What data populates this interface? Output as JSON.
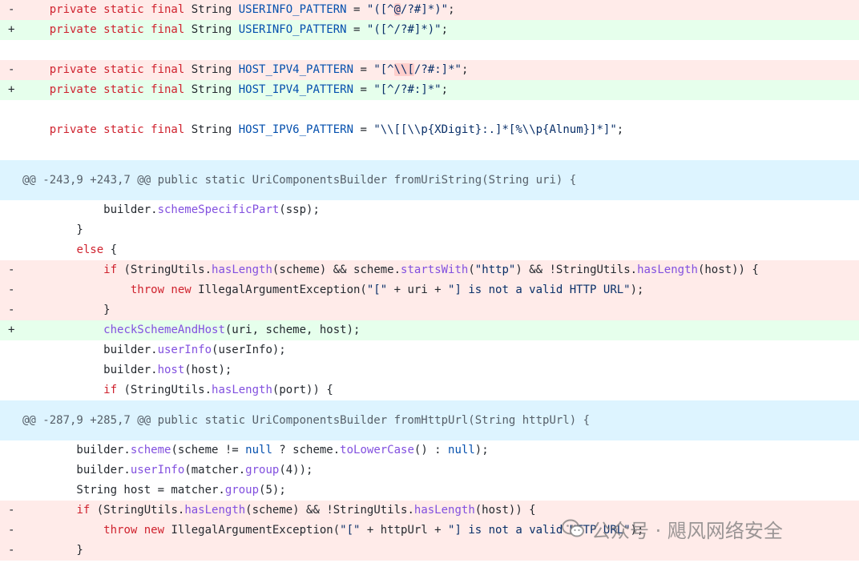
{
  "diff": {
    "rows": [
      {
        "type": "del",
        "marker": "-",
        "seg": [
          {
            "t": "    "
          },
          {
            "t": "private static final",
            "c": "kw"
          },
          {
            "t": " String "
          },
          {
            "t": "USERINFO_PATTERN",
            "c": "cf"
          },
          {
            "t": " = "
          },
          {
            "t": "\"([^",
            "c": "str"
          },
          {
            "t": "@",
            "c": "str hl"
          },
          {
            "t": "/?#]*)\"",
            "c": "str"
          },
          {
            "t": ";"
          }
        ]
      },
      {
        "type": "add",
        "marker": "+",
        "seg": [
          {
            "t": "    "
          },
          {
            "t": "private static final",
            "c": "kw"
          },
          {
            "t": " String "
          },
          {
            "t": "USERINFO_PATTERN",
            "c": "cf"
          },
          {
            "t": " = "
          },
          {
            "t": "\"([^/?#]*)\"",
            "c": "str"
          },
          {
            "t": ";"
          }
        ]
      },
      {
        "type": "blank",
        "marker": "",
        "seg": []
      },
      {
        "type": "del",
        "marker": "-",
        "seg": [
          {
            "t": "    "
          },
          {
            "t": "private static final",
            "c": "kw"
          },
          {
            "t": " String "
          },
          {
            "t": "HOST_IPV4_PATTERN",
            "c": "cf"
          },
          {
            "t": " = "
          },
          {
            "t": "\"[^",
            "c": "str"
          },
          {
            "t": "\\\\[",
            "c": "str hl"
          },
          {
            "t": "/?#:]*\"",
            "c": "str"
          },
          {
            "t": ";"
          }
        ]
      },
      {
        "type": "add",
        "marker": "+",
        "seg": [
          {
            "t": "    "
          },
          {
            "t": "private static final",
            "c": "kw"
          },
          {
            "t": " String "
          },
          {
            "t": "HOST_IPV4_PATTERN",
            "c": "cf"
          },
          {
            "t": " = "
          },
          {
            "t": "\"[^/?#:]*\"",
            "c": "str"
          },
          {
            "t": ";"
          }
        ]
      },
      {
        "type": "blank",
        "marker": "",
        "seg": []
      },
      {
        "type": "ctx",
        "marker": "",
        "seg": [
          {
            "t": "    "
          },
          {
            "t": "private static final",
            "c": "kw"
          },
          {
            "t": " String "
          },
          {
            "t": "HOST_IPV6_PATTERN",
            "c": "cf"
          },
          {
            "t": " = "
          },
          {
            "t": "\"\\\\[[\\\\p{XDigit}:.]*[%\\\\p{Alnum}]*]\"",
            "c": "str"
          },
          {
            "t": ";"
          }
        ]
      },
      {
        "type": "blank",
        "marker": "",
        "seg": []
      },
      {
        "type": "hunk",
        "text": "@@ -243,9 +243,7 @@ public static UriComponentsBuilder fromUriString(String uri) {"
      },
      {
        "type": "ctx",
        "marker": "",
        "seg": [
          {
            "t": "            builder."
          },
          {
            "t": "schemeSpecificPart",
            "c": "fn"
          },
          {
            "t": "(ssp);"
          }
        ]
      },
      {
        "type": "ctx",
        "marker": "",
        "seg": [
          {
            "t": "        }"
          }
        ]
      },
      {
        "type": "ctx",
        "marker": "",
        "seg": [
          {
            "t": "        "
          },
          {
            "t": "else",
            "c": "kw"
          },
          {
            "t": " {"
          }
        ]
      },
      {
        "type": "del",
        "marker": "-",
        "seg": [
          {
            "t": "            "
          },
          {
            "t": "if",
            "c": "kw"
          },
          {
            "t": " (StringUtils."
          },
          {
            "t": "hasLength",
            "c": "fn"
          },
          {
            "t": "(scheme) && scheme."
          },
          {
            "t": "startsWith",
            "c": "fn"
          },
          {
            "t": "("
          },
          {
            "t": "\"http\"",
            "c": "str"
          },
          {
            "t": ") && !StringUtils."
          },
          {
            "t": "hasLength",
            "c": "fn"
          },
          {
            "t": "(host)) {"
          }
        ]
      },
      {
        "type": "del",
        "marker": "-",
        "seg": [
          {
            "t": "                "
          },
          {
            "t": "throw new",
            "c": "kw"
          },
          {
            "t": " IllegalArgumentException("
          },
          {
            "t": "\"[\"",
            "c": "str"
          },
          {
            "t": " + uri + "
          },
          {
            "t": "\"] is not a valid HTTP URL\"",
            "c": "str"
          },
          {
            "t": ");"
          }
        ]
      },
      {
        "type": "del",
        "marker": "-",
        "seg": [
          {
            "t": "            }"
          }
        ]
      },
      {
        "type": "add",
        "marker": "+",
        "seg": [
          {
            "t": "            "
          },
          {
            "t": "checkSchemeAndHost",
            "c": "fn"
          },
          {
            "t": "(uri, scheme, host);"
          }
        ]
      },
      {
        "type": "ctx",
        "marker": "",
        "seg": [
          {
            "t": "            builder."
          },
          {
            "t": "userInfo",
            "c": "fn"
          },
          {
            "t": "(userInfo);"
          }
        ]
      },
      {
        "type": "ctx",
        "marker": "",
        "seg": [
          {
            "t": "            builder."
          },
          {
            "t": "host",
            "c": "fn"
          },
          {
            "t": "(host);"
          }
        ]
      },
      {
        "type": "ctx",
        "marker": "",
        "seg": [
          {
            "t": "            "
          },
          {
            "t": "if",
            "c": "kw"
          },
          {
            "t": " (StringUtils."
          },
          {
            "t": "hasLength",
            "c": "fn"
          },
          {
            "t": "(port)) {"
          }
        ]
      },
      {
        "type": "hunk",
        "text": "@@ -287,9 +285,7 @@ public static UriComponentsBuilder fromHttpUrl(String httpUrl) {"
      },
      {
        "type": "ctx",
        "marker": "",
        "seg": [
          {
            "t": "        builder."
          },
          {
            "t": "scheme",
            "c": "fn"
          },
          {
            "t": "(scheme != "
          },
          {
            "t": "null",
            "c": "cf"
          },
          {
            "t": " ? scheme."
          },
          {
            "t": "toLowerCase",
            "c": "fn"
          },
          {
            "t": "() : "
          },
          {
            "t": "null",
            "c": "cf"
          },
          {
            "t": ");"
          }
        ]
      },
      {
        "type": "ctx",
        "marker": "",
        "seg": [
          {
            "t": "        builder."
          },
          {
            "t": "userInfo",
            "c": "fn"
          },
          {
            "t": "(matcher."
          },
          {
            "t": "group",
            "c": "fn"
          },
          {
            "t": "(4));"
          }
        ]
      },
      {
        "type": "ctx",
        "marker": "",
        "seg": [
          {
            "t": "        String host = matcher."
          },
          {
            "t": "group",
            "c": "fn"
          },
          {
            "t": "(5);"
          }
        ]
      },
      {
        "type": "del",
        "marker": "-",
        "seg": [
          {
            "t": "        "
          },
          {
            "t": "if",
            "c": "kw"
          },
          {
            "t": " (StringUtils."
          },
          {
            "t": "hasLength",
            "c": "fn"
          },
          {
            "t": "(scheme) && !StringUtils."
          },
          {
            "t": "hasLength",
            "c": "fn"
          },
          {
            "t": "(host)) {"
          }
        ]
      },
      {
        "type": "del",
        "marker": "-",
        "seg": [
          {
            "t": "            "
          },
          {
            "t": "throw new",
            "c": "kw"
          },
          {
            "t": " IllegalArgumentException("
          },
          {
            "t": "\"[\"",
            "c": "str"
          },
          {
            "t": " + httpUrl + "
          },
          {
            "t": "\"] is not a valid HTTP URL\"",
            "c": "str"
          },
          {
            "t": ");"
          }
        ]
      },
      {
        "type": "del",
        "marker": "-",
        "seg": [
          {
            "t": "        }"
          }
        ]
      }
    ]
  },
  "watermark": {
    "text": "公众号 · 飓风网络安全",
    "icon": "wechat-official-account-icon"
  },
  "colors": {
    "deleted_bg": "#ffebe9",
    "added_bg": "#e6ffec",
    "hunk_bg": "#ddf4ff",
    "keyword": "#cf222e",
    "method": "#8250df",
    "constant": "#0550ae",
    "string": "#0a3069"
  }
}
